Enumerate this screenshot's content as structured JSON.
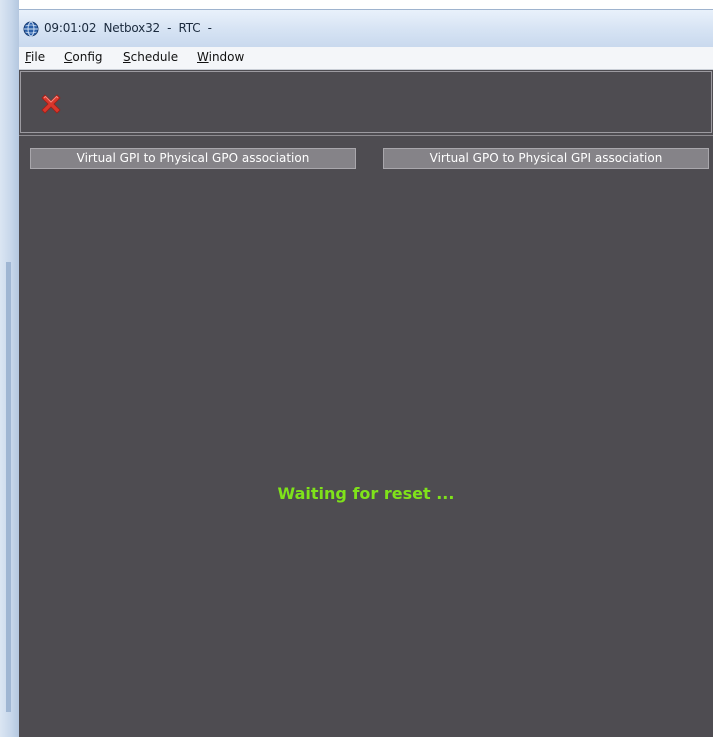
{
  "window": {
    "title": "09:01:02  Netbox32  -  RTC  -"
  },
  "menu": {
    "items": [
      {
        "accel": "F",
        "rest": "ile"
      },
      {
        "accel": "C",
        "rest": "onfig"
      },
      {
        "accel": "S",
        "rest": "chedule"
      },
      {
        "accel": "W",
        "rest": "indow"
      }
    ]
  },
  "toolbar": {
    "close_icon": "close-icon (red X)"
  },
  "tabs": [
    {
      "label": "Virtual GPI to Physical GPO association"
    },
    {
      "label": "Virtual GPO to Physical GPI association"
    }
  ],
  "status": {
    "message": "Waiting for reset ..."
  },
  "colors": {
    "content_bg": "#4e4c51",
    "status_text": "#7fe21a",
    "close_icon": "#d9362b",
    "tab_bg": "#858388"
  }
}
